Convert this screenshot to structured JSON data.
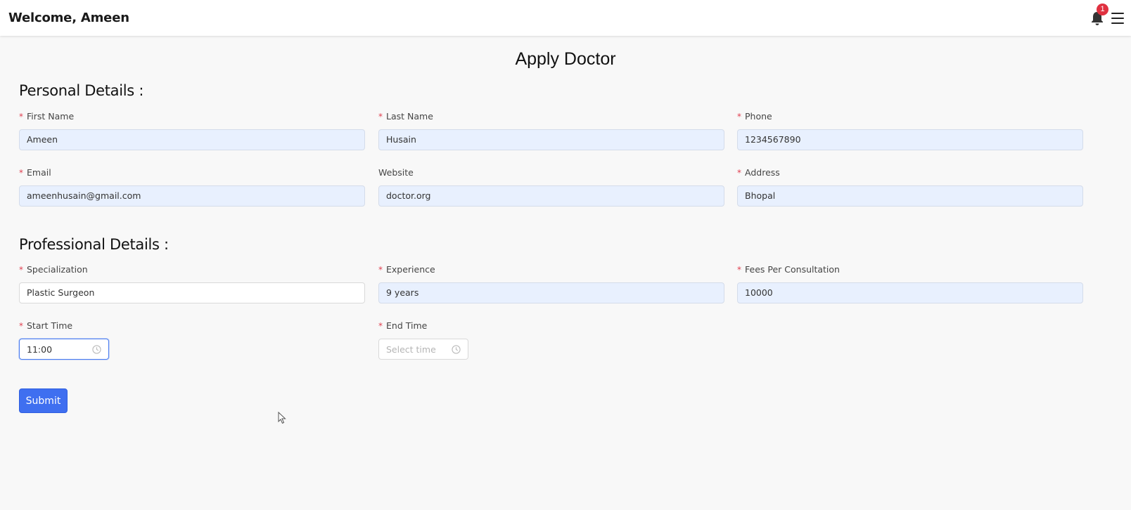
{
  "header": {
    "welcome_text": "Welcome, Ameen",
    "notification_count": "1"
  },
  "page": {
    "title": "Apply Doctor"
  },
  "personal": {
    "title": "Personal Details :",
    "first_name": {
      "label": "First Name",
      "value": "Ameen"
    },
    "last_name": {
      "label": "Last Name",
      "value": "Husain"
    },
    "phone": {
      "label": "Phone",
      "value": "1234567890"
    },
    "email": {
      "label": "Email",
      "value": "ameenhusain@gmail.com"
    },
    "website": {
      "label": "Website",
      "value": "doctor.org"
    },
    "address": {
      "label": "Address",
      "value": "Bhopal"
    }
  },
  "professional": {
    "title": "Professional Details :",
    "specialization": {
      "label": "Specialization",
      "value": "Plastic Surgeon"
    },
    "experience": {
      "label": "Experience",
      "value": "9 years"
    },
    "fees": {
      "label": "Fees Per Consultation",
      "value": "10000"
    },
    "start_time": {
      "label": "Start Time",
      "value": "11:00"
    },
    "end_time": {
      "label": "End Time",
      "placeholder": "Select time"
    }
  },
  "form": {
    "submit_label": "Submit"
  },
  "colors": {
    "primary": "#3f6ff0",
    "required": "#e04050",
    "badge": "#e03140",
    "autofill_bg": "#e8f0fe"
  }
}
